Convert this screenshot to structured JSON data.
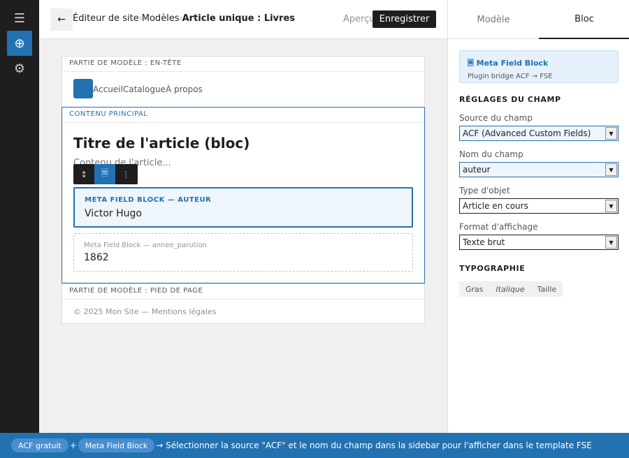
{
  "header": {
    "breadcrumbs": [
      "Éditeur de site",
      "Modèles",
      "Article unique : Livres"
    ],
    "separator": "›",
    "preview_label": "Aperçu",
    "save_label": "Enregistrer"
  },
  "leftbar": {
    "items": [
      "menu-icon",
      "add-block-icon",
      "settings-icon"
    ],
    "active": "add-block-icon"
  },
  "sidebar": {
    "tabs": [
      "Modèle",
      "Bloc"
    ],
    "active_tab": "Bloc",
    "plugin": {
      "title": "🗏 Meta Field Block",
      "subtitle": "Plugin bridge ACF → FSE"
    },
    "field_settings_title": "RÉGLAGES DU CHAMP",
    "fields": [
      {
        "label": "Source du champ",
        "value": "ACF (Advanced Custom Fields)"
      },
      {
        "label": "Nom du champ",
        "value": "auteur"
      },
      {
        "label": "Type d'objet",
        "value": "Article en cours"
      },
      {
        "label": "Format d'affichage",
        "value": "Texte brut"
      }
    ],
    "typography_title": "TYPOGRAPHIE",
    "typography_buttons": [
      "Gras",
      "Italique",
      "Taille"
    ]
  },
  "canvas": {
    "header_part": {
      "label": "PARTIE DE MODÈLE : EN-TÊTE",
      "nav": [
        "Accueil",
        "Catalogue",
        "À propos"
      ]
    },
    "main_part": {
      "label": "CONTENU PRINCIPAL",
      "post_title": "Titre de l'article (bloc)",
      "post_content": "Contenu de l'article...",
      "toolbar_buttons": [
        "↕",
        "🗏",
        "⋮"
      ],
      "selected_block": {
        "label": "META FIELD BLOCK — AUTEUR",
        "value": "Victor Hugo"
      },
      "other_block": {
        "label": "Meta Field Block — annee_parution",
        "value": "1862"
      }
    },
    "footer_part": {
      "label": "PARTIE DE MODÈLE : PIED DE PAGE",
      "text": "© 2025 Mon Site — Mentions légales"
    }
  },
  "infobar": {
    "pill1": "ACF gratuit",
    "plus": "+",
    "pill2": "Meta Field Block",
    "text": "→ Sélectionner la source \"ACF\" et le nom du champ dans la sidebar pour l'afficher dans le template FSE"
  },
  "colors": {
    "accent": "#2271b1",
    "dark": "#1e1e1e",
    "canvas_bg": "#f0f0f1"
  }
}
